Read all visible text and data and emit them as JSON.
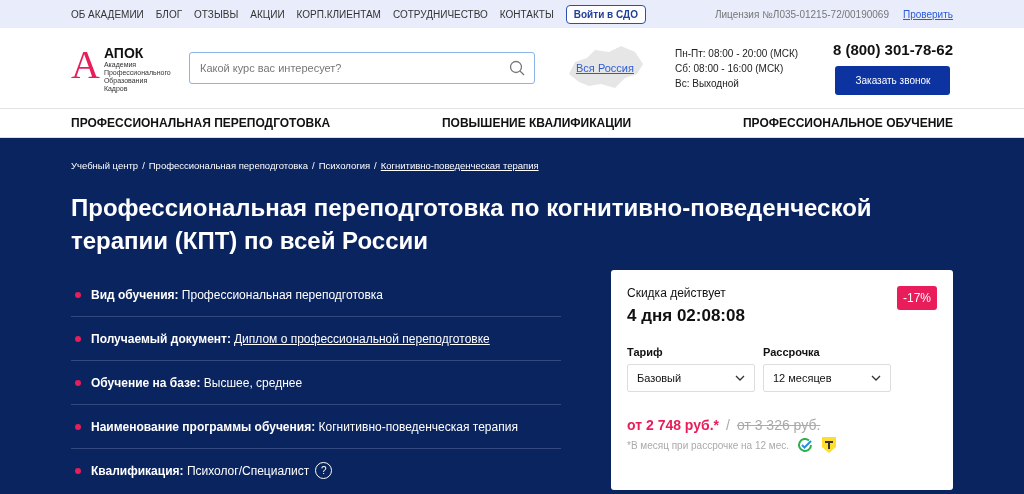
{
  "top_bar": {
    "links": [
      "ОБ АКАДЕМИИ",
      "БЛОГ",
      "ОТЗЫВЫ",
      "АКЦИИ",
      "КОРП.КЛИЕНТАМ",
      "СОТРУДНИЧЕСТВО",
      "КОНТАКТЫ"
    ],
    "login_button": "Войти в СДО",
    "license": "Лицензия №Л035-01215-72/00190069",
    "verify_link": "Проверить"
  },
  "header": {
    "logo_mark": "А",
    "logo_name": "АПОК",
    "logo_subtitle": [
      "Академия",
      "Профессионального",
      "Образования",
      "Кадров"
    ],
    "search": {
      "placeholder": "Какой курс вас интересует?"
    },
    "region_link": "Вся Россия",
    "hours": [
      "Пн-Пт: 08:00 - 20:00 (МСК)",
      "Сб: 08:00 - 16:00 (МСК)",
      "Вс: Выходной"
    ],
    "phone": "8 (800) 301-78-62",
    "callback_button": "Заказать звонок"
  },
  "nav": [
    "ПРОФЕССИОНАЛЬНАЯ ПЕРЕПОДГОТОВКА",
    "ПОВЫШЕНИЕ КВАЛИФИКАЦИИ",
    "ПРОФЕССИОНАЛЬНОЕ ОБУЧЕНИЕ"
  ],
  "breadcrumb_separator": "/",
  "breadcrumbs": [
    {
      "label": "Учебный центр",
      "current": false
    },
    {
      "label": "Профессиональная переподготовка",
      "current": false
    },
    {
      "label": "Психология",
      "current": false
    },
    {
      "label": "Когнитивно-поведенческая терапия",
      "current": true
    }
  ],
  "title": "Профессиональная переподготовка по когнитивно-поведенческой терапии (КПТ) по всей России",
  "facts": [
    {
      "label": "Вид обучения:",
      "value": "Профессиональная переподготовка",
      "kind": "text"
    },
    {
      "label": "Получаемый документ:",
      "value": "Диплом о профессиональной переподготовке",
      "kind": "link"
    },
    {
      "label": "Обучение на базе:",
      "value": "Высшее, среднее",
      "kind": "text"
    },
    {
      "label": "Наименование программы обучения:",
      "value": "Когнитивно-поведенческая терапия",
      "kind": "text"
    },
    {
      "label": "Квалификация:",
      "value": "Психолог/Специалист",
      "kind": "help",
      "help_mark": "?"
    }
  ],
  "offer": {
    "caption": "Скидка действует",
    "countdown": "4 дня 02:08:08",
    "discount": "-17%",
    "selects": [
      {
        "label": "Тариф",
        "value": "Базовый"
      },
      {
        "label": "Рассрочка",
        "value": "12 месяцев"
      }
    ],
    "price": "от 2 748 руб.*",
    "separator": "/",
    "old_price": "от 3 326 руб.",
    "note": "*В месяц при рассрочке на 12 мес."
  }
}
